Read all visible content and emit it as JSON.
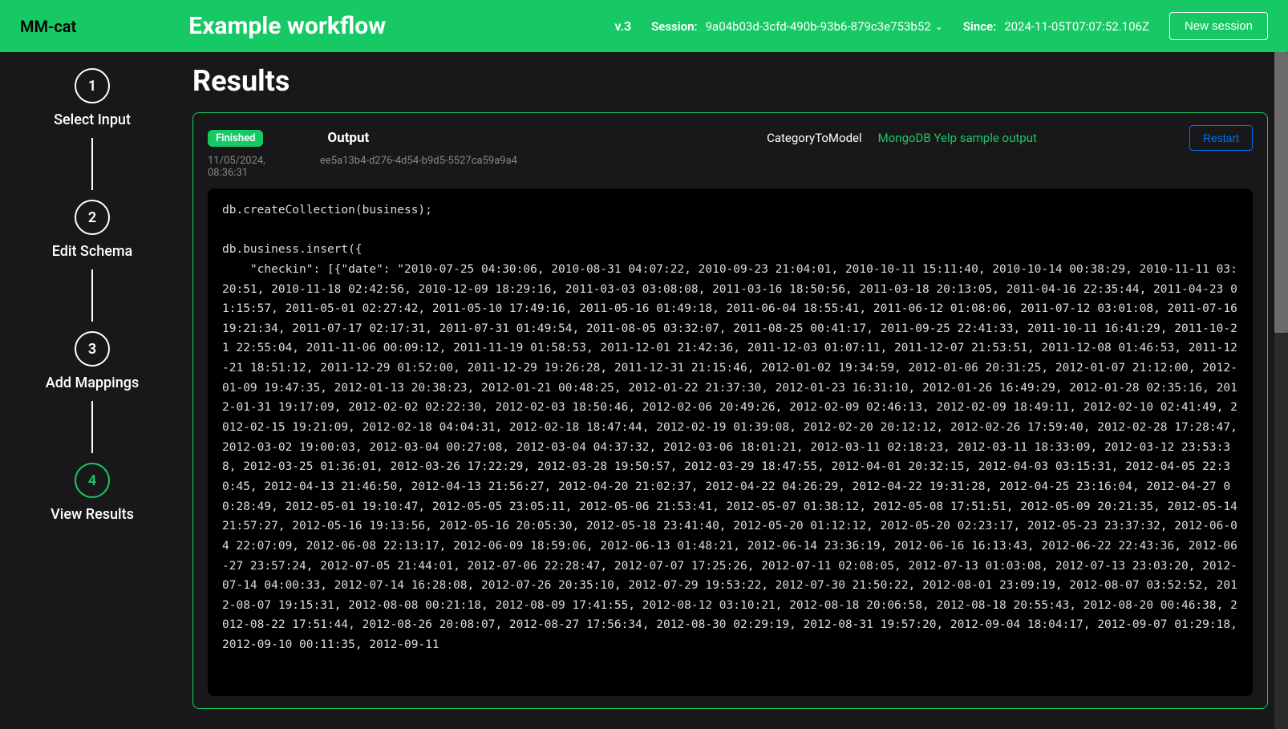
{
  "header": {
    "logo": "MM-cat",
    "workflow_title": "Example workflow",
    "version": "v.3",
    "session_label": "Session:",
    "session_id": "9a04b03d-3cfd-490b-93b6-879c3e753b52",
    "since_label": "Since:",
    "since_value": "2024-11-05T07:07:52.106Z",
    "new_session_button": "New session"
  },
  "sidebar": {
    "steps": [
      {
        "num": "1",
        "label": "Select Input"
      },
      {
        "num": "2",
        "label": "Edit Schema"
      },
      {
        "num": "3",
        "label": "Add Mappings"
      },
      {
        "num": "4",
        "label": "View Results"
      }
    ]
  },
  "content": {
    "page_title": "Results",
    "status": "Finished",
    "output_label": "Output",
    "category": "CategoryToModel",
    "output_link": "MongoDB Yelp sample output",
    "restart_button": "Restart",
    "timestamp": "11/05/2024, 08:36:31",
    "job_id": "ee5a13b4-d276-4d54-b9d5-5527ca59a9a4",
    "code": "db.createCollection(business);\n\ndb.business.insert({\n    \"checkin\": [{\"date\": \"2010-07-25 04:30:06, 2010-08-31 04:07:22, 2010-09-23 21:04:01, 2010-10-11 15:11:40, 2010-10-14 00:38:29, 2010-11-11 03:20:51, 2010-11-18 02:42:56, 2010-12-09 18:29:16, 2011-03-03 03:08:08, 2011-03-16 18:50:56, 2011-03-18 20:13:05, 2011-04-16 22:35:44, 2011-04-23 01:15:57, 2011-05-01 02:27:42, 2011-05-10 17:49:16, 2011-05-16 01:49:18, 2011-06-04 18:55:41, 2011-06-12 01:08:06, 2011-07-12 03:01:08, 2011-07-16 19:21:34, 2011-07-17 02:17:31, 2011-07-31 01:49:54, 2011-08-05 03:32:07, 2011-08-25 00:41:17, 2011-09-25 22:41:33, 2011-10-11 16:41:29, 2011-10-21 22:55:04, 2011-11-06 00:09:12, 2011-11-19 01:58:53, 2011-12-01 21:42:36, 2011-12-03 01:07:11, 2011-12-07 21:53:51, 2011-12-08 01:46:53, 2011-12-21 18:51:12, 2011-12-29 01:52:00, 2011-12-29 19:26:28, 2011-12-31 21:15:46, 2012-01-02 19:34:59, 2012-01-06 20:31:25, 2012-01-07 21:12:00, 2012-01-09 19:47:35, 2012-01-13 20:38:23, 2012-01-21 00:48:25, 2012-01-22 21:37:30, 2012-01-23 16:31:10, 2012-01-26 16:49:29, 2012-01-28 02:35:16, 2012-01-31 19:17:09, 2012-02-02 02:22:30, 2012-02-03 18:50:46, 2012-02-06 20:49:26, 2012-02-09 02:46:13, 2012-02-09 18:49:11, 2012-02-10 02:41:49, 2012-02-15 19:21:09, 2012-02-18 04:04:31, 2012-02-18 18:47:44, 2012-02-19 01:39:08, 2012-02-20 20:12:12, 2012-02-26 17:59:40, 2012-02-28 17:28:47, 2012-03-02 19:00:03, 2012-03-04 00:27:08, 2012-03-04 04:37:32, 2012-03-06 18:01:21, 2012-03-11 02:18:23, 2012-03-11 18:33:09, 2012-03-12 23:53:38, 2012-03-25 01:36:01, 2012-03-26 17:22:29, 2012-03-28 19:50:57, 2012-03-29 18:47:55, 2012-04-01 20:32:15, 2012-04-03 03:15:31, 2012-04-05 22:30:45, 2012-04-13 21:46:50, 2012-04-13 21:56:27, 2012-04-20 21:02:37, 2012-04-22 04:26:29, 2012-04-22 19:31:28, 2012-04-25 23:16:04, 2012-04-27 00:28:49, 2012-05-01 19:10:47, 2012-05-05 23:05:11, 2012-05-06 21:53:41, 2012-05-07 01:38:12, 2012-05-08 17:51:51, 2012-05-09 20:21:35, 2012-05-14 21:57:27, 2012-05-16 19:13:56, 2012-05-16 20:05:30, 2012-05-18 23:41:40, 2012-05-20 01:12:12, 2012-05-20 02:23:17, 2012-05-23 23:37:32, 2012-06-04 22:07:09, 2012-06-08 22:13:17, 2012-06-09 18:59:06, 2012-06-13 01:48:21, 2012-06-14 23:36:19, 2012-06-16 16:13:43, 2012-06-22 22:43:36, 2012-06-27 23:57:24, 2012-07-05 21:44:01, 2012-07-06 22:28:47, 2012-07-07 17:25:26, 2012-07-11 02:08:05, 2012-07-13 01:03:08, 2012-07-13 23:03:20, 2012-07-14 04:00:33, 2012-07-14 16:28:08, 2012-07-26 20:35:10, 2012-07-29 19:53:22, 2012-07-30 21:50:22, 2012-08-01 23:09:19, 2012-08-07 03:52:52, 2012-08-07 19:15:31, 2012-08-08 00:21:18, 2012-08-09 17:41:55, 2012-08-12 03:10:21, 2012-08-18 20:06:58, 2012-08-18 20:55:43, 2012-08-20 00:46:38, 2012-08-22 17:51:44, 2012-08-26 20:08:07, 2012-08-27 17:56:34, 2012-08-30 02:29:19, 2012-08-31 19:57:20, 2012-09-04 18:04:17, 2012-09-07 01:29:18, 2012-09-10 00:11:35, 2012-09-11"
  }
}
